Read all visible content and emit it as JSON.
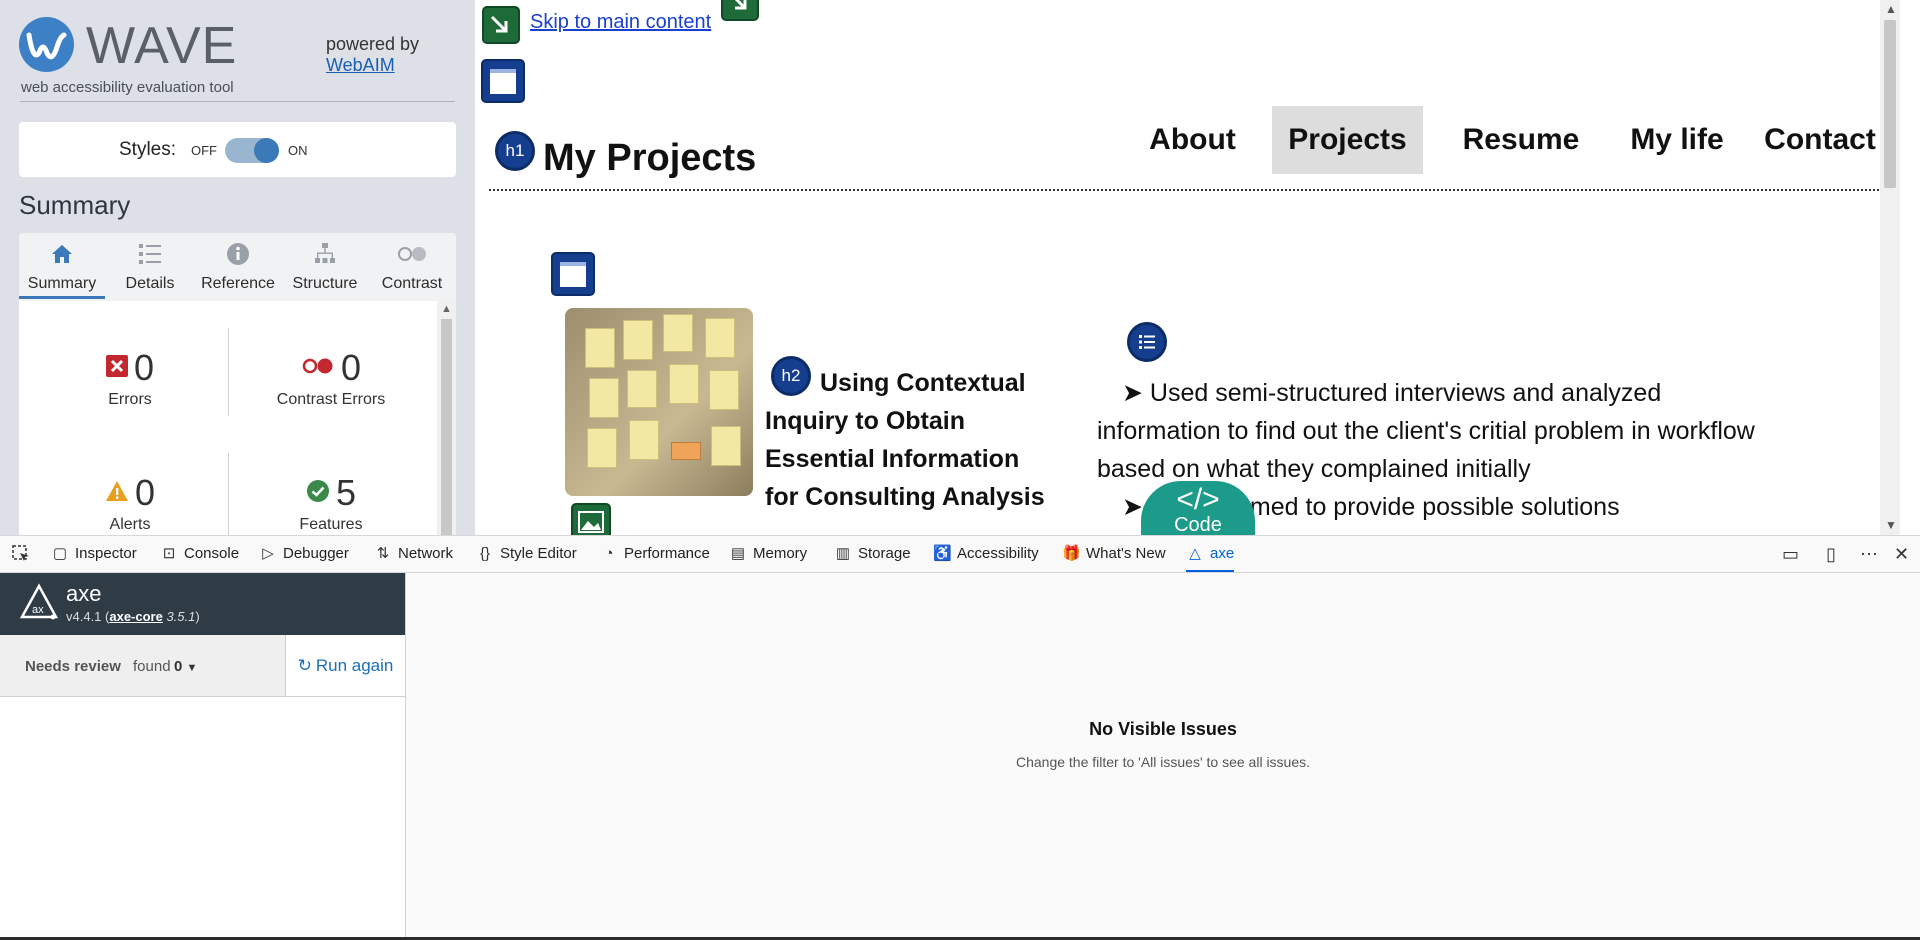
{
  "wave": {
    "name": "WAVE",
    "tagline": "web accessibility evaluation tool",
    "powered_by": "powered by",
    "webaim_link": "WebAIM",
    "styles_label": "Styles:",
    "styles_off": "OFF",
    "styles_on": "ON",
    "summary_heading": "Summary",
    "tabs": [
      {
        "label": "Summary",
        "icon": "home-icon"
      },
      {
        "label": "Details",
        "icon": "list-icon"
      },
      {
        "label": "Reference",
        "icon": "info-icon"
      },
      {
        "label": "Structure",
        "icon": "hierarchy-icon"
      },
      {
        "label": "Contrast",
        "icon": "contrast-icon"
      }
    ],
    "stats": {
      "errors": {
        "value": "0",
        "label": "Errors"
      },
      "contrast_errors": {
        "value": "0",
        "label": "Contrast Errors"
      },
      "alerts": {
        "value": "0",
        "label": "Alerts"
      },
      "features": {
        "value": "5",
        "label": "Features"
      }
    },
    "colors": {
      "accent": "#3b79b9",
      "error": "#c3272f",
      "alert": "#e8a01e",
      "feature": "#3a8a4c"
    }
  },
  "page": {
    "skip_link": "Skip to main content",
    "h1_badge": "h1",
    "h1_title": "My Projects",
    "nav": [
      "About",
      "Projects",
      "Resume",
      "My life",
      "Contact"
    ],
    "selected_nav": "Projects",
    "h2_badge": "h2",
    "h2_title_lines": [
      "Using Contextual",
      "Inquiry to Obtain",
      "Essential Information",
      "for Consulting Analysis"
    ],
    "list_lines": [
      "➤ Used semi-structured interviews and analyzed",
      "information to find out the client's critial problem in workflow",
      "based on what they complained initially",
      "➤ Brainstormed to provide possible solutions"
    ],
    "code_badge_symbol": "</>",
    "code_badge_label": "Code"
  },
  "devtools": {
    "tabs": [
      {
        "label": "Inspector",
        "icon": "inspector-icon"
      },
      {
        "label": "Console",
        "icon": "console-icon"
      },
      {
        "label": "Debugger",
        "icon": "debugger-icon"
      },
      {
        "label": "Network",
        "icon": "network-icon"
      },
      {
        "label": "Style Editor",
        "icon": "style-editor-icon"
      },
      {
        "label": "Performance",
        "icon": "performance-icon"
      },
      {
        "label": "Memory",
        "icon": "memory-icon"
      },
      {
        "label": "Storage",
        "icon": "storage-icon"
      },
      {
        "label": "Accessibility",
        "icon": "accessibility-icon"
      },
      {
        "label": "What's New",
        "icon": "gift-icon"
      },
      {
        "label": "axe",
        "icon": "axe-icon"
      }
    ],
    "selected_tab": "axe"
  },
  "axe": {
    "name": "axe",
    "version": "v4.4.1 (",
    "core_link": "axe-core",
    "core_version": " 3.5.1",
    "version_close": ")",
    "filter_label": "Needs review",
    "filter_found": "found",
    "filter_count": "0",
    "run_again": "Run again",
    "no_issues_title": "No Visible Issues",
    "no_issues_hint": "Change the filter to 'All issues' to see all issues."
  }
}
